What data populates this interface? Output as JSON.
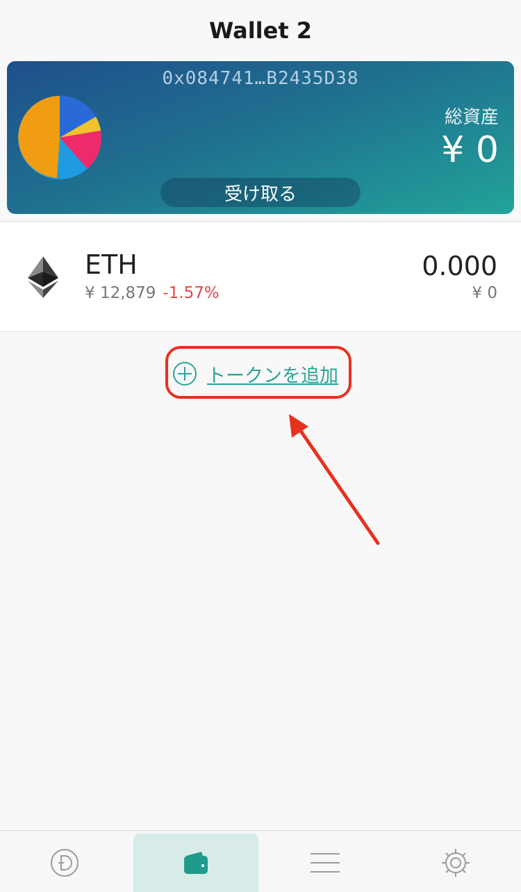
{
  "header": {
    "title": "Wallet 2"
  },
  "wallet": {
    "address": "0x084741…B2435D38",
    "total_label": "総資産",
    "total_value": "¥ 0",
    "receive_label": "受け取る"
  },
  "tokens": [
    {
      "symbol": "ETH",
      "price": "¥ 12,879",
      "change": "-1.57%",
      "amount": "0.000",
      "value": "¥ 0"
    }
  ],
  "add_token": {
    "label": "トークンを追加"
  },
  "tabbar": {
    "tabs": [
      {
        "icon": "dapp-icon"
      },
      {
        "icon": "wallet-icon",
        "active": true
      },
      {
        "icon": "menu-icon"
      },
      {
        "icon": "settings-icon"
      }
    ]
  },
  "colors": {
    "accent": "#2aa496",
    "negative": "#e04848",
    "annotation": "#e8311f"
  }
}
